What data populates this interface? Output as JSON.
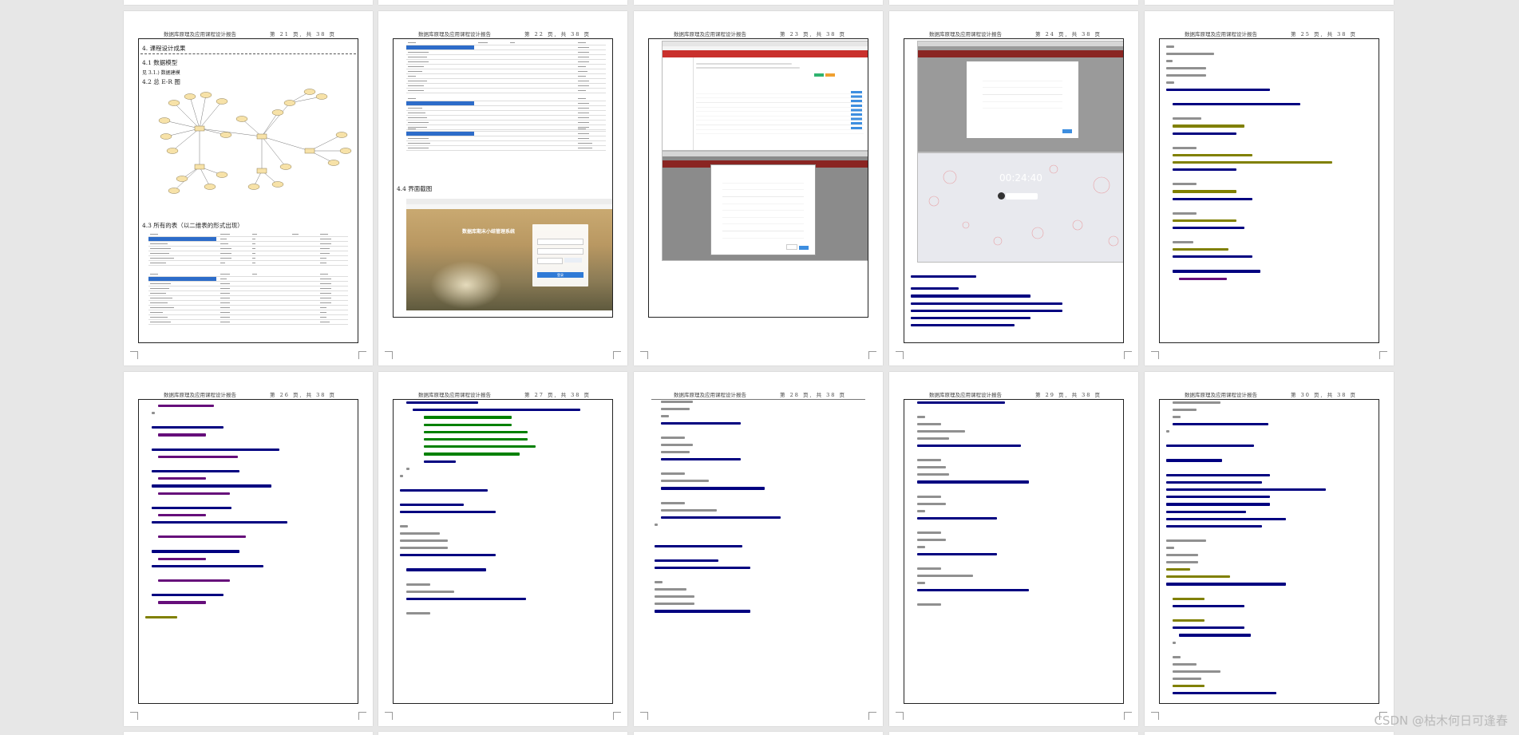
{
  "document": {
    "header_title": "数据库原理及应用课程设计报告",
    "pages": [
      {
        "number_label": "第 21 页, 共 38 页"
      },
      {
        "number_label": "第 22 页, 共 38 页"
      },
      {
        "number_label": "第 23 页, 共 38 页"
      },
      {
        "number_label": "第 24 页, 共 38 页"
      },
      {
        "number_label": "第 25 页, 共 38 页"
      },
      {
        "number_label": "第 26 页, 共 38 页"
      },
      {
        "number_label": "第 27 页, 共 38 页"
      },
      {
        "number_label": "第 28 页, 共 38 页"
      },
      {
        "number_label": "第 29 页, 共 38 页"
      },
      {
        "number_label": "第 30 页, 共 38 页"
      }
    ],
    "page21": {
      "h_results": "4. 课程设计成果",
      "h_data_model": "4.1 数据模型",
      "h_data_model_sub": "见 3.1.) 数据建模",
      "h_er": "4.2 总 E-R 图",
      "h_tables": "4.3 所有的表（以二维表的形式出现）"
    },
    "page22": {
      "h_ui": "4.4 界面截图",
      "login_title": "数据库期末小结管理系统",
      "login_button": "登录"
    },
    "page24": {
      "clock": "00:24:40"
    }
  },
  "watermark": "CSDN @枯木何日可逢春",
  "colors": {
    "background": "#e7e7e7",
    "code_keyword": "#000080",
    "code_annotation": "#808000",
    "code_comment": "#808080",
    "code_string": "#008000",
    "code_field": "#660e7a",
    "er_entity": "#f7e2a8",
    "ui_red": "#c9302c"
  }
}
